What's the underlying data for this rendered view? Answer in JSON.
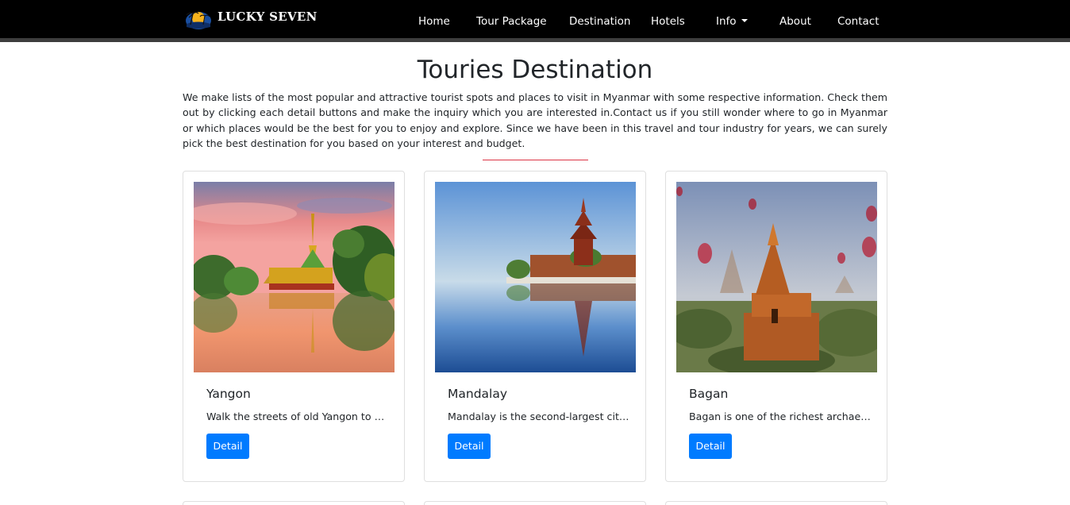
{
  "navbar": {
    "brand": "LUCKY SEVEN",
    "brand_logo_icon": "sunset-palm-logo-icon",
    "items": [
      {
        "label": "Home"
      },
      {
        "label": "Tour Package"
      },
      {
        "label": "Destination"
      },
      {
        "label": "Hotels"
      },
      {
        "label": "Info",
        "has_dropdown": true
      },
      {
        "label": "About"
      },
      {
        "label": "Contact"
      }
    ],
    "background": "#000000"
  },
  "header": {
    "title": "Touries Destination",
    "intro": "We make lists of the most popular and attractive tourist spots and places to visit in Myanmar with some respective information. Check them out by clicking each detail buttons and make the inquiry which you are interested in.Contact us if you still wonder where to go in Myanmar or which places would be the best for you to enjoy and explore. Since we have been in this travel and tour industry for years, we can surely pick the best destination for you based on your interest and budget.",
    "divider_color": "#dc3545"
  },
  "destinations": [
    {
      "title": "Yangon",
      "text": "Walk the streets of old Yangon to s...",
      "button": "Detail",
      "image": "yangon-karaweik-palace-image"
    },
    {
      "title": "Mandalay",
      "text": "Mandalay is the second-largest city ...",
      "button": "Detail",
      "image": "mandalay-palace-moat-image"
    },
    {
      "title": "Bagan",
      "text": "Bagan is one of the richest archaeol...",
      "button": "Detail",
      "image": "bagan-temples-balloons-image"
    }
  ],
  "colors": {
    "button": "#007bff",
    "button_text": "#ffffff",
    "card_border": "#dfdfdf"
  }
}
